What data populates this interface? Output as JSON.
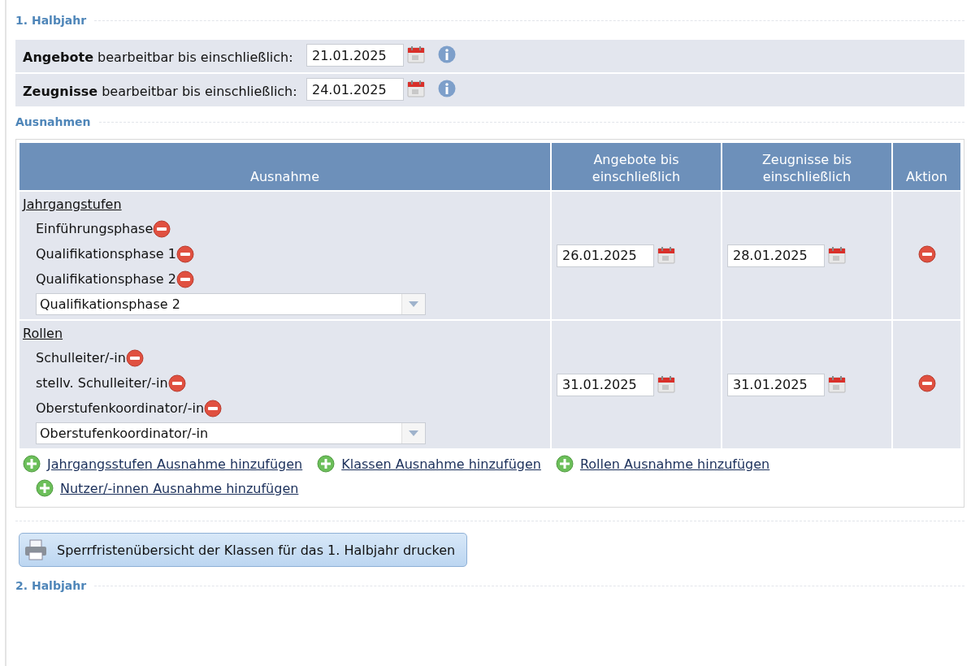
{
  "half_year_1": {
    "heading": "1. Halbjahr",
    "settings": [
      {
        "label": "**Angebote** bearbeitbar bis einschließlich:",
        "date": "21.01.2025"
      },
      {
        "label": "**Zeugnisse** bearbeitbar bis einschließlich:",
        "date": "24.01.2025"
      }
    ],
    "exceptions": {
      "heading": "Ausnahmen",
      "columns": [
        "Ausnahme",
        "Angebote bis einschließlich",
        "Zeugnisse bis einschließlich",
        "Aktion"
      ],
      "rows": [
        {
          "group": "Jahrgangstufen",
          "items": [
            "Einführungsphase",
            "Qualifikationsphase 1",
            "Qualifikationsphase 2"
          ],
          "select": "Qualifikationsphase 2",
          "offers_date": "26.01.2025",
          "reports_date": "28.01.2025"
        },
        {
          "group": "Rollen",
          "items": [
            "Schulleiter/-in",
            "stellv. Schulleiter/-in",
            "Oberstufenkoordinator/-in"
          ],
          "select": "Oberstufenkoordinator/-in",
          "offers_date": "31.01.2025",
          "reports_date": "31.01.2025"
        }
      ],
      "add_links": [
        "Jahrgangsstufen Ausnahme hinzufügen",
        "Klassen Ausnahme hinzufügen",
        "Rollen Ausnahme hinzufügen",
        "Nutzer/-innen Ausnahme hinzufügen"
      ]
    },
    "print_button": "Sperrfristenübersicht der Klassen für das 1. Halbjahr drucken"
  },
  "half_year_2": {
    "heading": "2. Halbjahr"
  }
}
